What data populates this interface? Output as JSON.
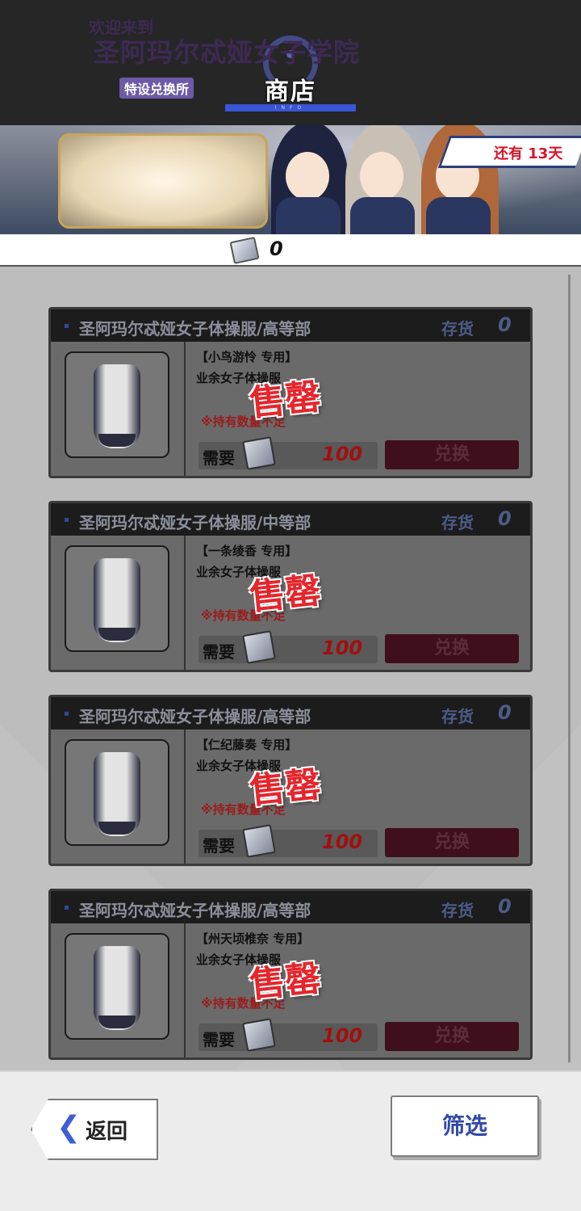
{
  "header": {
    "title": "商店",
    "info_label": "INFO"
  },
  "banner": {
    "logo_line1": "欢迎来到",
    "logo_line2": "圣阿玛尔忒娅女子学院",
    "logo_line3": "特设兑换所",
    "days_left": "还有 13天"
  },
  "currency": {
    "icon": "ticket-icon",
    "amount": "0"
  },
  "items": [
    {
      "name": "圣阿玛尔忒娅女子体操服/高等部",
      "stock_label": "存货",
      "stock": "0",
      "user": "【小鸟游怜 专用】",
      "desc": "业余女子体操服",
      "soldout": "售罄",
      "warning": "※持有数量不足",
      "need_label": "需要",
      "cost": "100",
      "exchange": "兑换"
    },
    {
      "name": "圣阿玛尔忒娅女子体操服/中等部",
      "stock_label": "存货",
      "stock": "0",
      "user": "【一条绫香 专用】",
      "desc": "业余女子体操服",
      "soldout": "售罄",
      "warning": "※持有数量不足",
      "need_label": "需要",
      "cost": "100",
      "exchange": "兑换"
    },
    {
      "name": "圣阿玛尔忒娅女子体操服/高等部",
      "stock_label": "存货",
      "stock": "0",
      "user": "【仁纪藤奏 专用】",
      "desc": "业余女子体操服",
      "soldout": "售罄",
      "warning": "※持有数量不足",
      "need_label": "需要",
      "cost": "100",
      "exchange": "兑换"
    },
    {
      "name": "圣阿玛尔忒娅女子体操服/高等部",
      "stock_label": "存货",
      "stock": "0",
      "user": "【州天顷椎奈 专用】",
      "desc": "业余女子体操服",
      "soldout": "售罄",
      "warning": "※持有数量不足",
      "need_label": "需要",
      "cost": "100",
      "exchange": "兑换"
    }
  ],
  "footer": {
    "back_label": "返回",
    "filter_label": "筛选"
  }
}
